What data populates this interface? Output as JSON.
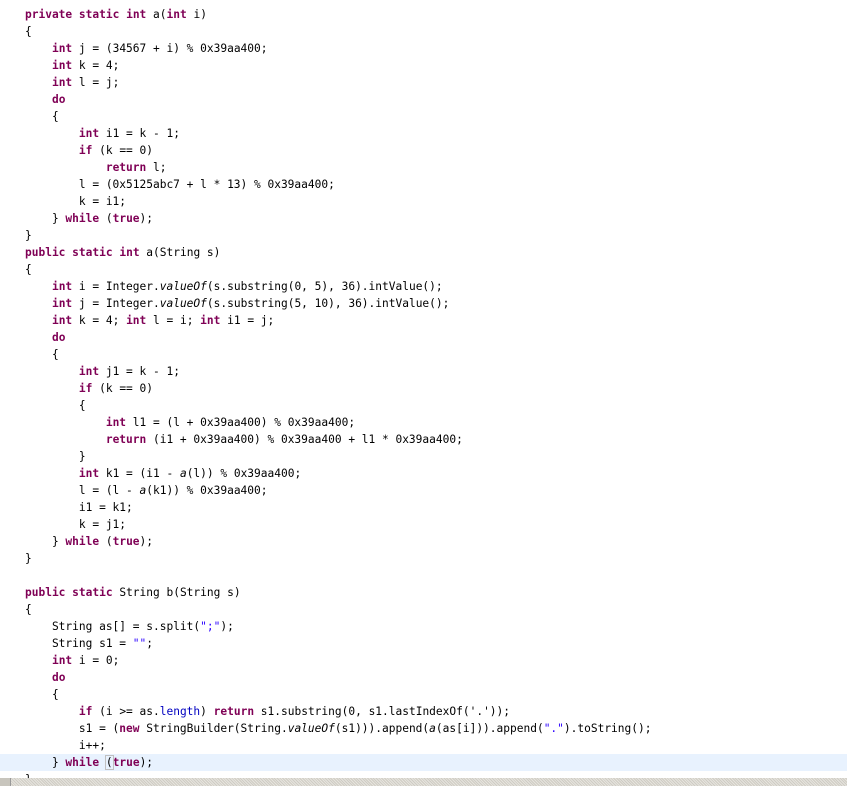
{
  "editor": {
    "language": "java",
    "current_line": 44,
    "colors": {
      "keyword": "#7f0055",
      "string": "#2a00ff",
      "field": "#0000c0",
      "current_line": "#e8f2fe"
    },
    "lines": [
      [
        [
          "kw",
          "private"
        ],
        [
          "t",
          " "
        ],
        [
          "kw",
          "static"
        ],
        [
          "t",
          " "
        ],
        [
          "kw",
          "int"
        ],
        [
          "t",
          " a("
        ],
        [
          "kw",
          "int"
        ],
        [
          "t",
          " i)"
        ]
      ],
      [
        [
          "t",
          "{"
        ]
      ],
      [
        [
          "t",
          "    "
        ],
        [
          "kw",
          "int"
        ],
        [
          "t",
          " j = (34567 + i) % 0x39aa400;"
        ]
      ],
      [
        [
          "t",
          "    "
        ],
        [
          "kw",
          "int"
        ],
        [
          "t",
          " k = 4;"
        ]
      ],
      [
        [
          "t",
          "    "
        ],
        [
          "kw",
          "int"
        ],
        [
          "t",
          " l = j;"
        ]
      ],
      [
        [
          "t",
          "    "
        ],
        [
          "kw",
          "do"
        ]
      ],
      [
        [
          "t",
          "    {"
        ]
      ],
      [
        [
          "t",
          "        "
        ],
        [
          "kw",
          "int"
        ],
        [
          "t",
          " i1 = k - 1;"
        ]
      ],
      [
        [
          "t",
          "        "
        ],
        [
          "kw",
          "if"
        ],
        [
          "t",
          " (k == 0)"
        ]
      ],
      [
        [
          "t",
          "            "
        ],
        [
          "kw",
          "return"
        ],
        [
          "t",
          " l;"
        ]
      ],
      [
        [
          "t",
          "        l = (0x5125abc7 + l * 13) % 0x39aa400;"
        ]
      ],
      [
        [
          "t",
          "        k = i1;"
        ]
      ],
      [
        [
          "t",
          "    } "
        ],
        [
          "kw",
          "while"
        ],
        [
          "t",
          " ("
        ],
        [
          "kw",
          "true"
        ],
        [
          "t",
          ");"
        ]
      ],
      [
        [
          "t",
          "}"
        ]
      ],
      [
        [
          "kw",
          "public"
        ],
        [
          "t",
          " "
        ],
        [
          "kw",
          "static"
        ],
        [
          "t",
          " "
        ],
        [
          "kw",
          "int"
        ],
        [
          "t",
          " a(String s)"
        ]
      ],
      [
        [
          "t",
          "{"
        ]
      ],
      [
        [
          "t",
          "    "
        ],
        [
          "kw",
          "int"
        ],
        [
          "t",
          " i = Integer."
        ],
        [
          "it",
          "valueOf"
        ],
        [
          "t",
          "(s.substring(0, 5), 36).intValue();"
        ]
      ],
      [
        [
          "t",
          "    "
        ],
        [
          "kw",
          "int"
        ],
        [
          "t",
          " j = Integer."
        ],
        [
          "it",
          "valueOf"
        ],
        [
          "t",
          "(s.substring(5, 10), 36).intValue();"
        ]
      ],
      [
        [
          "t",
          "    "
        ],
        [
          "kw",
          "int"
        ],
        [
          "t",
          " k = 4; "
        ],
        [
          "kw",
          "int"
        ],
        [
          "t",
          " l = i; "
        ],
        [
          "kw",
          "int"
        ],
        [
          "t",
          " i1 = j;"
        ]
      ],
      [
        [
          "t",
          "    "
        ],
        [
          "kw",
          "do"
        ]
      ],
      [
        [
          "t",
          "    {"
        ]
      ],
      [
        [
          "t",
          "        "
        ],
        [
          "kw",
          "int"
        ],
        [
          "t",
          " j1 = k - 1;"
        ]
      ],
      [
        [
          "t",
          "        "
        ],
        [
          "kw",
          "if"
        ],
        [
          "t",
          " (k == 0)"
        ]
      ],
      [
        [
          "t",
          "        {"
        ]
      ],
      [
        [
          "t",
          "            "
        ],
        [
          "kw",
          "int"
        ],
        [
          "t",
          " l1 = (l + 0x39aa400) % 0x39aa400;"
        ]
      ],
      [
        [
          "t",
          "            "
        ],
        [
          "kw",
          "return"
        ],
        [
          "t",
          " (i1 + 0x39aa400) % 0x39aa400 + l1 * 0x39aa400;"
        ]
      ],
      [
        [
          "t",
          "        }"
        ]
      ],
      [
        [
          "t",
          "        "
        ],
        [
          "kw",
          "int"
        ],
        [
          "t",
          " k1 = (i1 - "
        ],
        [
          "it",
          "a"
        ],
        [
          "t",
          "(l)) % 0x39aa400;"
        ]
      ],
      [
        [
          "t",
          "        l = (l - "
        ],
        [
          "it",
          "a"
        ],
        [
          "t",
          "(k1)) % 0x39aa400;"
        ]
      ],
      [
        [
          "t",
          "        i1 = k1;"
        ]
      ],
      [
        [
          "t",
          "        k = j1;"
        ]
      ],
      [
        [
          "t",
          "    } "
        ],
        [
          "kw",
          "while"
        ],
        [
          "t",
          " ("
        ],
        [
          "kw",
          "true"
        ],
        [
          "t",
          ");"
        ]
      ],
      [
        [
          "t",
          "}"
        ]
      ],
      [
        [
          "t",
          ""
        ]
      ],
      [
        [
          "kw",
          "public"
        ],
        [
          "t",
          " "
        ],
        [
          "kw",
          "static"
        ],
        [
          "t",
          " String b(String s)"
        ]
      ],
      [
        [
          "t",
          "{"
        ]
      ],
      [
        [
          "t",
          "    String as[] = s.split("
        ],
        [
          "str",
          "\";\""
        ],
        [
          "t",
          ");"
        ]
      ],
      [
        [
          "t",
          "    String s1 = "
        ],
        [
          "str",
          "\"\""
        ],
        [
          "t",
          ";"
        ]
      ],
      [
        [
          "t",
          "    "
        ],
        [
          "kw",
          "int"
        ],
        [
          "t",
          " i = 0;"
        ]
      ],
      [
        [
          "t",
          "    "
        ],
        [
          "kw",
          "do"
        ]
      ],
      [
        [
          "t",
          "    {"
        ]
      ],
      [
        [
          "t",
          "        "
        ],
        [
          "kw",
          "if"
        ],
        [
          "t",
          " (i >= as."
        ],
        [
          "fld",
          "length"
        ],
        [
          "t",
          ") "
        ],
        [
          "kw",
          "return"
        ],
        [
          "t",
          " s1.substring(0, s1.lastIndexOf('.'));"
        ]
      ],
      [
        [
          "t",
          "        s1 = ("
        ],
        [
          "kw",
          "new"
        ],
        [
          "t",
          " StringBuilder(String."
        ],
        [
          "it",
          "valueOf"
        ],
        [
          "t",
          "(s1))).append("
        ],
        [
          "it",
          "a"
        ],
        [
          "t",
          "(as[i])).append("
        ],
        [
          "str",
          "\".\""
        ],
        [
          "t",
          ").toString();"
        ]
      ],
      [
        [
          "t",
          "        i++;"
        ]
      ],
      [
        [
          "t",
          "    } "
        ],
        [
          "kw",
          "while"
        ],
        [
          "t",
          " "
        ],
        [
          "br",
          "("
        ],
        [
          "kw",
          "true"
        ],
        [
          "t",
          ");"
        ]
      ],
      [
        [
          "t",
          "}"
        ]
      ]
    ]
  }
}
